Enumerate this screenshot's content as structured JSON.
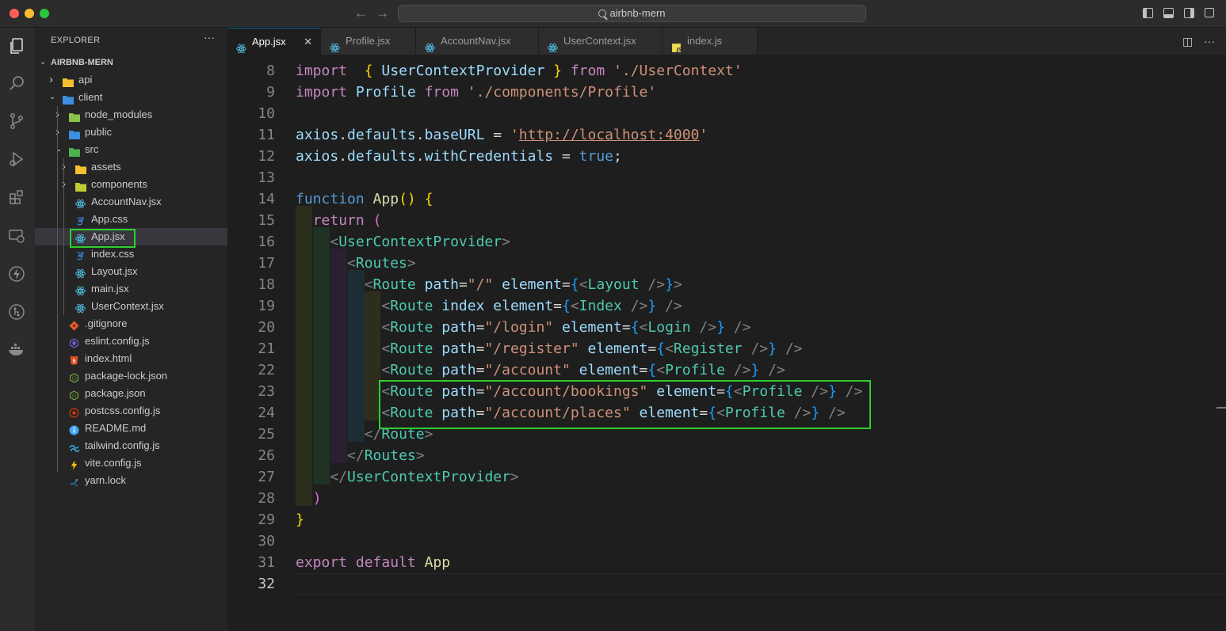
{
  "window": {
    "search_text": "airbnb-mern",
    "traffic_lights": [
      "#ff5f57",
      "#febc2e",
      "#28c840"
    ]
  },
  "activity_bar": [
    {
      "name": "files-icon"
    },
    {
      "name": "search-icon"
    },
    {
      "name": "source-control-icon"
    },
    {
      "name": "run-debug-icon"
    },
    {
      "name": "extensions-icon"
    },
    {
      "name": "remote-explorer-icon"
    },
    {
      "name": "thunder-icon"
    },
    {
      "name": "gitlens-icon"
    },
    {
      "name": "docker-icon"
    }
  ],
  "explorer": {
    "title": "EXPLORER",
    "more": "···",
    "root": "AIRBNB-MERN",
    "tree": [
      {
        "label": "api",
        "depth": 1,
        "type": "folder",
        "expanded": false,
        "icon": "folder-api-icon",
        "color": "#f4c02f"
      },
      {
        "label": "client",
        "depth": 1,
        "type": "folder",
        "expanded": true,
        "icon": "folder-client-icon",
        "color": "#3b8ee0"
      },
      {
        "label": "node_modules",
        "depth": 2,
        "type": "folder",
        "expanded": false,
        "icon": "folder-node-icon",
        "color": "#8bc34a"
      },
      {
        "label": "public",
        "depth": 2,
        "type": "folder",
        "expanded": false,
        "icon": "folder-public-icon",
        "color": "#3b8ee0"
      },
      {
        "label": "src",
        "depth": 2,
        "type": "folder",
        "expanded": true,
        "icon": "folder-src-icon",
        "color": "#4caf50"
      },
      {
        "label": "assets",
        "depth": 3,
        "type": "folder",
        "expanded": false,
        "icon": "folder-assets-icon",
        "color": "#f4c02f"
      },
      {
        "label": "components",
        "depth": 3,
        "type": "folder",
        "expanded": false,
        "icon": "folder-components-icon",
        "color": "#c0ca33"
      },
      {
        "label": "AccountNav.jsx",
        "depth": 3,
        "type": "file",
        "icon": "react-icon",
        "color": "#4fc3e8"
      },
      {
        "label": "App.css",
        "depth": 3,
        "type": "file",
        "icon": "css-icon",
        "color": "#3f8ae6"
      },
      {
        "label": "App.jsx",
        "depth": 3,
        "type": "file",
        "icon": "react-icon",
        "color": "#4fc3e8",
        "selected": true
      },
      {
        "label": "index.css",
        "depth": 3,
        "type": "file",
        "icon": "css-icon",
        "color": "#3f8ae6"
      },
      {
        "label": "Layout.jsx",
        "depth": 3,
        "type": "file",
        "icon": "react-icon",
        "color": "#4fc3e8"
      },
      {
        "label": "main.jsx",
        "depth": 3,
        "type": "file",
        "icon": "react-icon",
        "color": "#4fc3e8"
      },
      {
        "label": "UserContext.jsx",
        "depth": 3,
        "type": "file",
        "icon": "react-icon",
        "color": "#4fc3e8"
      },
      {
        "label": ".gitignore",
        "depth": 2,
        "type": "file",
        "icon": "git-icon",
        "color": "#e4572e"
      },
      {
        "label": "eslint.config.js",
        "depth": 2,
        "type": "file",
        "icon": "eslint-icon",
        "color": "#6c63d8"
      },
      {
        "label": "index.html",
        "depth": 2,
        "type": "file",
        "icon": "html-icon",
        "color": "#e44d26"
      },
      {
        "label": "package-lock.json",
        "depth": 2,
        "type": "file",
        "icon": "nodejs-icon",
        "color": "#7cb342"
      },
      {
        "label": "package.json",
        "depth": 2,
        "type": "file",
        "icon": "nodejs-icon",
        "color": "#7cb342"
      },
      {
        "label": "postcss.config.js",
        "depth": 2,
        "type": "file",
        "icon": "postcss-icon",
        "color": "#dd3a0a"
      },
      {
        "label": "README.md",
        "depth": 2,
        "type": "file",
        "icon": "info-icon",
        "color": "#42a5f5"
      },
      {
        "label": "tailwind.config.js",
        "depth": 2,
        "type": "file",
        "icon": "tailwind-icon",
        "color": "#38bdf8"
      },
      {
        "label": "vite.config.js",
        "depth": 2,
        "type": "file",
        "icon": "vite-icon",
        "color": "#ffc107"
      },
      {
        "label": "yarn.lock",
        "depth": 2,
        "type": "file",
        "icon": "yarn-icon",
        "color": "#2c8ebb"
      }
    ]
  },
  "tabs": [
    {
      "label": "App.jsx",
      "active": true,
      "icon": "react-icon",
      "close": "✕"
    },
    {
      "label": "Profile.jsx",
      "active": false,
      "icon": "react-icon"
    },
    {
      "label": "AccountNav.jsx",
      "active": false,
      "icon": "react-icon"
    },
    {
      "label": "UserContext.jsx",
      "active": false,
      "icon": "react-icon"
    },
    {
      "label": "index.js",
      "active": false,
      "icon": "js-icon"
    }
  ],
  "editor": {
    "current_line": 32,
    "lines": [
      {
        "n": 8,
        "tokens": [
          [
            "kp",
            "import"
          ],
          [
            "",
            "  "
          ],
          [
            "b1",
            "{"
          ],
          [
            "",
            " "
          ],
          [
            "v",
            "UserContextProvider"
          ],
          [
            "",
            " "
          ],
          [
            "b1",
            "}"
          ],
          [
            "",
            " "
          ],
          [
            "kp",
            "from"
          ],
          [
            "",
            " "
          ],
          [
            "s",
            "'./UserContext'"
          ]
        ]
      },
      {
        "n": 9,
        "tokens": [
          [
            "kp",
            "import"
          ],
          [
            "",
            " "
          ],
          [
            "v",
            "Profile"
          ],
          [
            "",
            " "
          ],
          [
            "kp",
            "from"
          ],
          [
            "",
            " "
          ],
          [
            "s",
            "'./components/Profile'"
          ]
        ]
      },
      {
        "n": 10,
        "tokens": []
      },
      {
        "n": 11,
        "tokens": [
          [
            "v",
            "axios"
          ],
          [
            "",
            "."
          ],
          [
            "v",
            "defaults"
          ],
          [
            "",
            "."
          ],
          [
            "v",
            "baseURL"
          ],
          [
            "",
            " = "
          ],
          [
            "s",
            "'"
          ],
          [
            "su",
            "http://localhost:4000"
          ],
          [
            "s",
            "'"
          ]
        ]
      },
      {
        "n": 12,
        "tokens": [
          [
            "v",
            "axios"
          ],
          [
            "",
            "."
          ],
          [
            "v",
            "defaults"
          ],
          [
            "",
            "."
          ],
          [
            "v",
            "withCredentials"
          ],
          [
            "",
            " = "
          ],
          [
            "k",
            "true"
          ],
          [
            "",
            ";"
          ]
        ]
      },
      {
        "n": 13,
        "tokens": []
      },
      {
        "n": 14,
        "tokens": [
          [
            "k",
            "function"
          ],
          [
            "",
            " "
          ],
          [
            "fn",
            "App"
          ],
          [
            "b1",
            "()"
          ],
          [
            "",
            " "
          ],
          [
            "b1",
            "{"
          ]
        ]
      },
      {
        "n": 15,
        "tokens": [
          [
            "",
            "  "
          ],
          [
            "kp",
            "return"
          ],
          [
            "",
            " "
          ],
          [
            "b2",
            "("
          ]
        ]
      },
      {
        "n": 16,
        "tokens": [
          [
            "",
            "    "
          ],
          [
            "pu",
            "<"
          ],
          [
            "tg",
            "UserContextProvider"
          ],
          [
            "pu",
            ">"
          ]
        ]
      },
      {
        "n": 17,
        "tokens": [
          [
            "",
            "      "
          ],
          [
            "pu",
            "<"
          ],
          [
            "tg",
            "Routes"
          ],
          [
            "pu",
            ">"
          ]
        ]
      },
      {
        "n": 18,
        "tokens": [
          [
            "",
            "        "
          ],
          [
            "pu",
            "<"
          ],
          [
            "tg",
            "Route"
          ],
          [
            "",
            " "
          ],
          [
            "v",
            "path"
          ],
          [
            "",
            "="
          ],
          [
            "s",
            "\"/\""
          ],
          [
            "",
            " "
          ],
          [
            "v",
            "element"
          ],
          [
            "",
            "="
          ],
          [
            "b3",
            "{"
          ],
          [
            "pu",
            "<"
          ],
          [
            "tg",
            "Layout"
          ],
          [
            "",
            " "
          ],
          [
            "pu",
            "/>"
          ],
          [
            "b3",
            "}"
          ],
          [
            "pu",
            ">"
          ]
        ]
      },
      {
        "n": 19,
        "tokens": [
          [
            "",
            "          "
          ],
          [
            "pu",
            "<"
          ],
          [
            "tg",
            "Route"
          ],
          [
            "",
            " "
          ],
          [
            "v",
            "index"
          ],
          [
            "",
            " "
          ],
          [
            "v",
            "element"
          ],
          [
            "",
            "="
          ],
          [
            "b3",
            "{"
          ],
          [
            "pu",
            "<"
          ],
          [
            "tg",
            "Index"
          ],
          [
            "",
            " "
          ],
          [
            "pu",
            "/>"
          ],
          [
            "b3",
            "}"
          ],
          [
            "",
            " "
          ],
          [
            "pu",
            "/>"
          ]
        ]
      },
      {
        "n": 20,
        "tokens": [
          [
            "",
            "          "
          ],
          [
            "pu",
            "<"
          ],
          [
            "tg",
            "Route"
          ],
          [
            "",
            " "
          ],
          [
            "v",
            "path"
          ],
          [
            "",
            "="
          ],
          [
            "s",
            "\"/login\""
          ],
          [
            "",
            " "
          ],
          [
            "v",
            "element"
          ],
          [
            "",
            "="
          ],
          [
            "b3",
            "{"
          ],
          [
            "pu",
            "<"
          ],
          [
            "tg",
            "Login"
          ],
          [
            "",
            " "
          ],
          [
            "pu",
            "/>"
          ],
          [
            "b3",
            "}"
          ],
          [
            "",
            " "
          ],
          [
            "pu",
            "/>"
          ]
        ]
      },
      {
        "n": 21,
        "tokens": [
          [
            "",
            "          "
          ],
          [
            "pu",
            "<"
          ],
          [
            "tg",
            "Route"
          ],
          [
            "",
            " "
          ],
          [
            "v",
            "path"
          ],
          [
            "",
            "="
          ],
          [
            "s",
            "\"/register\""
          ],
          [
            "",
            " "
          ],
          [
            "v",
            "element"
          ],
          [
            "",
            "="
          ],
          [
            "b3",
            "{"
          ],
          [
            "pu",
            "<"
          ],
          [
            "tg",
            "Register"
          ],
          [
            "",
            " "
          ],
          [
            "pu",
            "/>"
          ],
          [
            "b3",
            "}"
          ],
          [
            "",
            " "
          ],
          [
            "pu",
            "/>"
          ]
        ]
      },
      {
        "n": 22,
        "tokens": [
          [
            "",
            "          "
          ],
          [
            "pu",
            "<"
          ],
          [
            "tg",
            "Route"
          ],
          [
            "",
            " "
          ],
          [
            "v",
            "path"
          ],
          [
            "",
            "="
          ],
          [
            "s",
            "\"/account\""
          ],
          [
            "",
            " "
          ],
          [
            "v",
            "element"
          ],
          [
            "",
            "="
          ],
          [
            "b3",
            "{"
          ],
          [
            "pu",
            "<"
          ],
          [
            "tg",
            "Profile"
          ],
          [
            "",
            " "
          ],
          [
            "pu",
            "/>"
          ],
          [
            "b3",
            "}"
          ],
          [
            "",
            " "
          ],
          [
            "pu",
            "/>"
          ]
        ]
      },
      {
        "n": 23,
        "tokens": [
          [
            "",
            "          "
          ],
          [
            "pu",
            "<"
          ],
          [
            "tg",
            "Route"
          ],
          [
            "",
            " "
          ],
          [
            "v",
            "path"
          ],
          [
            "",
            "="
          ],
          [
            "s",
            "\"/account/bookings\""
          ],
          [
            "",
            " "
          ],
          [
            "v",
            "element"
          ],
          [
            "",
            "="
          ],
          [
            "b3",
            "{"
          ],
          [
            "pu",
            "<"
          ],
          [
            "tg",
            "Profile"
          ],
          [
            "",
            " "
          ],
          [
            "pu",
            "/>"
          ],
          [
            "b3",
            "}"
          ],
          [
            "",
            " "
          ],
          [
            "pu",
            "/>"
          ]
        ]
      },
      {
        "n": 24,
        "tokens": [
          [
            "",
            "          "
          ],
          [
            "pu",
            "<"
          ],
          [
            "tg",
            "Route"
          ],
          [
            "",
            " "
          ],
          [
            "v",
            "path"
          ],
          [
            "",
            "="
          ],
          [
            "s",
            "\"/account/places\""
          ],
          [
            "",
            " "
          ],
          [
            "v",
            "element"
          ],
          [
            "",
            "="
          ],
          [
            "b3",
            "{"
          ],
          [
            "pu",
            "<"
          ],
          [
            "tg",
            "Profile"
          ],
          [
            "",
            " "
          ],
          [
            "pu",
            "/>"
          ],
          [
            "b3",
            "}"
          ],
          [
            "",
            " "
          ],
          [
            "pu",
            "/>"
          ]
        ]
      },
      {
        "n": 25,
        "tokens": [
          [
            "",
            "        "
          ],
          [
            "pu",
            "</"
          ],
          [
            "tg",
            "Route"
          ],
          [
            "pu",
            ">"
          ]
        ]
      },
      {
        "n": 26,
        "tokens": [
          [
            "",
            "      "
          ],
          [
            "pu",
            "</"
          ],
          [
            "tg",
            "Routes"
          ],
          [
            "pu",
            ">"
          ]
        ]
      },
      {
        "n": 27,
        "tokens": [
          [
            "",
            "    "
          ],
          [
            "pu",
            "</"
          ],
          [
            "tg",
            "UserContextProvider"
          ],
          [
            "pu",
            ">"
          ]
        ]
      },
      {
        "n": 28,
        "tokens": [
          [
            "",
            "  "
          ],
          [
            "b2",
            ")"
          ]
        ]
      },
      {
        "n": 29,
        "tokens": [
          [
            "b1",
            "}"
          ]
        ]
      },
      {
        "n": 30,
        "tokens": []
      },
      {
        "n": 31,
        "tokens": [
          [
            "kp",
            "export"
          ],
          [
            "",
            " "
          ],
          [
            "kp",
            "default"
          ],
          [
            "",
            " "
          ],
          [
            "fn",
            "App"
          ]
        ]
      },
      {
        "n": 32,
        "tokens": []
      }
    ]
  },
  "colors": {
    "highlight_box": "#2fcf2f",
    "active_tab_border": "#0e639c"
  }
}
